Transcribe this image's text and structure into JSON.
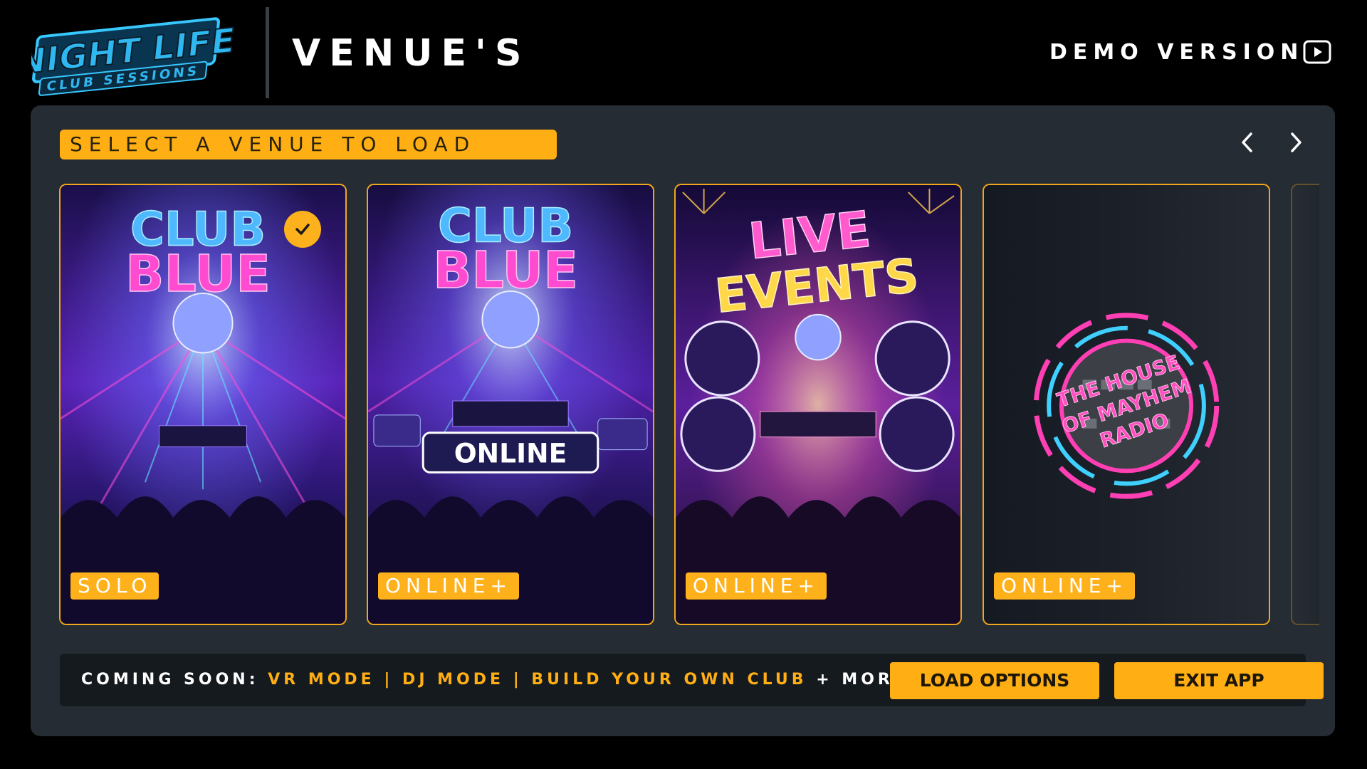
{
  "header": {
    "logo_text_main": "NIGHT LIFE",
    "logo_text_sub": "CLUB SESSIONS",
    "title": "VENUE'S",
    "demo_label": "DEMO VERSION",
    "play_icon": "play-icon"
  },
  "main": {
    "banner_label": "SELECT A VENUE TO LOAD",
    "prev_icon": "chevron-left-icon",
    "next_icon": "chevron-right-icon",
    "venues": [
      {
        "title_line1": "CLUB",
        "title_line2": "BLUE",
        "subtitle": "",
        "badge": "SOLO",
        "selected": true
      },
      {
        "title_line1": "CLUB",
        "title_line2": "BLUE",
        "subtitle": "ONLINE",
        "badge": "ONLINE+",
        "selected": false
      },
      {
        "title_line1": "LIVE",
        "title_line2": "EVENTS",
        "subtitle": "",
        "badge": "ONLINE+",
        "selected": false
      },
      {
        "title_line1": "THE HOUSE",
        "title_line2": "OF MAYHEM",
        "subtitle": "RADIO",
        "badge": "ONLINE+",
        "selected": false
      }
    ]
  },
  "footer": {
    "coming_soon_label": "COMING SOON:",
    "coming_soon_items": "VR MODE | DJ MODE | BUILD YOUR OWN CLUB",
    "more_label": "+ MORE!",
    "load_options": "LOAD OPTIONS",
    "exit_app": "EXIT APP"
  },
  "colors": {
    "accent": "#ffae14",
    "panel": "#262c33",
    "background": "#000000",
    "footer_bar": "#151a1f"
  }
}
